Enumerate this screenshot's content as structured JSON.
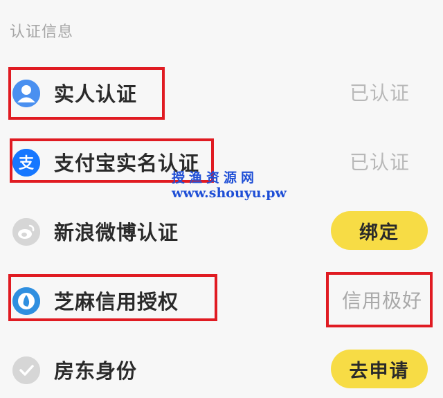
{
  "section": {
    "title": "认证信息"
  },
  "rows": [
    {
      "label": "实人认证",
      "status": "已认证",
      "icon": "person-icon"
    },
    {
      "label": "支付宝实名认证",
      "status": "已认证",
      "icon": "alipay-icon"
    },
    {
      "label": "新浪微博认证",
      "action": "绑定",
      "icon": "weibo-icon"
    },
    {
      "label": "芝麻信用授权",
      "status": "信用极好",
      "icon": "sesame-credit-icon"
    },
    {
      "label": "房东身份",
      "action": "去申请",
      "icon": "check-shield-icon"
    }
  ],
  "watermark": {
    "title": "授渔资源网",
    "url": "www.shouyu.pw"
  },
  "colors": {
    "accent": "#f7dc45",
    "highlight_box": "#e01b22",
    "watermark": "#1f4fd6",
    "muted_text": "#b8b8b8"
  }
}
